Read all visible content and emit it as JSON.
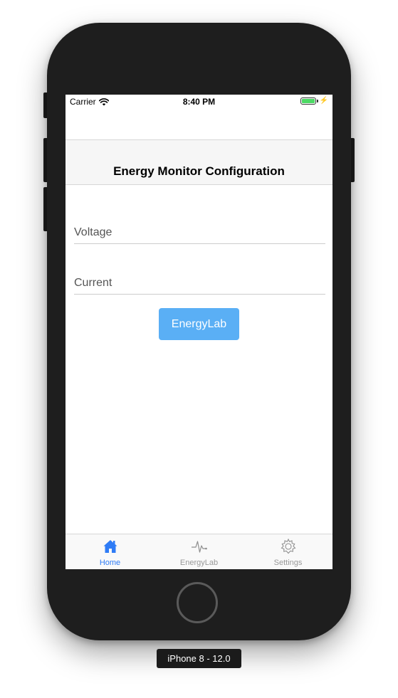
{
  "status_bar": {
    "carrier": "Carrier",
    "time": "8:40 PM",
    "battery_color": "#4cd964"
  },
  "nav": {
    "title": "Energy Monitor Configuration"
  },
  "form": {
    "voltage_placeholder": "Voltage",
    "current_placeholder": "Current",
    "button_label": "EnergyLab",
    "button_color": "#5aaff5"
  },
  "tabs": [
    {
      "label": "Home",
      "icon": "home-icon",
      "active": true
    },
    {
      "label": "EnergyLab",
      "icon": "pulse-icon",
      "active": false
    },
    {
      "label": "Settings",
      "icon": "gear-icon",
      "active": false
    }
  ],
  "accent_color": "#2f7cf6",
  "device_label": "iPhone 8 - 12.0"
}
